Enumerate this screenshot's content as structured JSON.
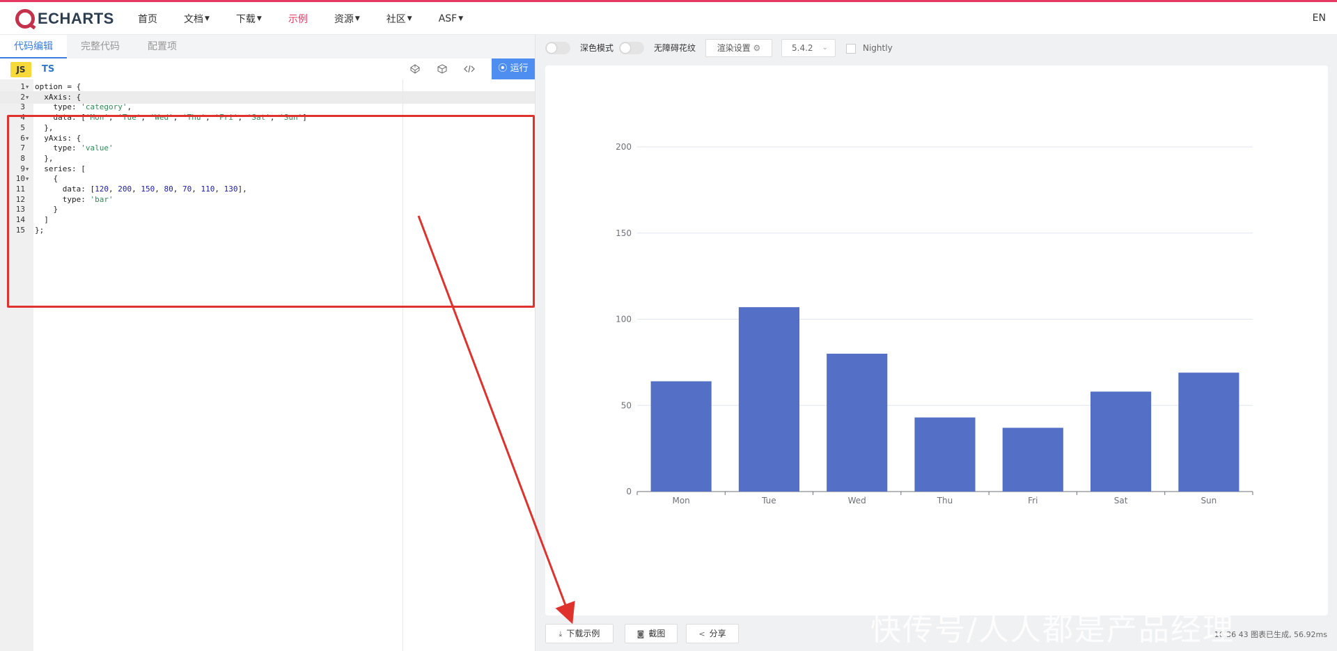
{
  "brand": {
    "name": "ECHARTS"
  },
  "nav": {
    "items": [
      {
        "label": "首页",
        "dropdown": false,
        "active": false
      },
      {
        "label": "文档",
        "dropdown": true,
        "active": false
      },
      {
        "label": "下载",
        "dropdown": true,
        "active": false
      },
      {
        "label": "示例",
        "dropdown": false,
        "active": true
      },
      {
        "label": "资源",
        "dropdown": true,
        "active": false
      },
      {
        "label": "社区",
        "dropdown": true,
        "active": false
      },
      {
        "label": "ASF",
        "dropdown": true,
        "active": false
      }
    ],
    "lang": "EN"
  },
  "editor": {
    "tabs": [
      {
        "label": "代码编辑",
        "active": true
      },
      {
        "label": "完整代码",
        "active": false
      },
      {
        "label": "配置项",
        "active": false
      }
    ],
    "lang_js": "JS",
    "lang_ts": "TS",
    "run_label": "运行",
    "lines": [
      {
        "n": "1",
        "fold": true,
        "text": "option = {"
      },
      {
        "n": "2",
        "fold": true,
        "text": "  xAxis: {"
      },
      {
        "n": "3",
        "fold": false,
        "text": "    type: 'category',"
      },
      {
        "n": "4",
        "fold": false,
        "text": "    data: ['Mon', 'Tue', 'Wed', 'Thu', 'Fri', 'Sat', 'Sun']"
      },
      {
        "n": "5",
        "fold": false,
        "text": "  },"
      },
      {
        "n": "6",
        "fold": true,
        "text": "  yAxis: {"
      },
      {
        "n": "7",
        "fold": false,
        "text": "    type: 'value'"
      },
      {
        "n": "8",
        "fold": false,
        "text": "  },"
      },
      {
        "n": "9",
        "fold": true,
        "text": "  series: ["
      },
      {
        "n": "10",
        "fold": true,
        "text": "    {"
      },
      {
        "n": "11",
        "fold": false,
        "text": "      data: [120, 200, 150, 80, 70, 110, 130],"
      },
      {
        "n": "12",
        "fold": false,
        "text": "      type: 'bar'"
      },
      {
        "n": "13",
        "fold": false,
        "text": "    }"
      },
      {
        "n": "14",
        "fold": false,
        "text": "  ]"
      },
      {
        "n": "15",
        "fold": false,
        "text": "};"
      }
    ]
  },
  "preview": {
    "dark_mode_label": "深色模式",
    "decal_label": "无障碍花纹",
    "render_settings_label": "渲染设置",
    "version": "5.4.2",
    "nightly_label": "Nightly",
    "download_label": "下载示例",
    "screenshot_label": "截图",
    "share_label": "分享",
    "status_text": "16 36 43   图表已生成, 56.92ms"
  },
  "watermark": "快传号/人人都是产品经理",
  "colors": {
    "accent": "#e43961",
    "bar": "#5470c6",
    "run": "#4d8ef0",
    "annotation": "#e0322d"
  },
  "chart_data": {
    "type": "bar",
    "categories": [
      "Mon",
      "Tue",
      "Wed",
      "Thu",
      "Fri",
      "Sat",
      "Sun"
    ],
    "values": [
      64,
      107,
      80,
      43,
      37,
      58,
      69
    ],
    "ylim": [
      0,
      200
    ],
    "yticks": [
      0,
      50,
      100,
      150,
      200
    ],
    "grid": true,
    "title": "",
    "xlabel": "",
    "ylabel": ""
  }
}
